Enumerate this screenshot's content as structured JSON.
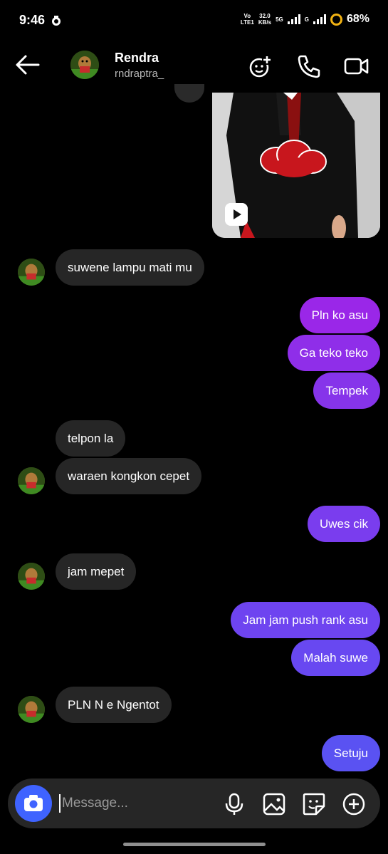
{
  "status_bar": {
    "time": "9:46",
    "volte_top": "Vo",
    "volte_bottom": "LTE1",
    "speed_top": "32.0",
    "speed_bottom": "KB/s",
    "net_5g": "5G",
    "net_g": "G",
    "battery": "68%"
  },
  "header": {
    "name": "Rendra",
    "username": "rndraptra_",
    "icons": [
      "back-arrow-icon",
      "add-effects-icon",
      "phone-icon",
      "video-icon"
    ]
  },
  "messages": [
    {
      "from": "them",
      "text": "suwene lampu mati mu"
    },
    {
      "from": "me",
      "text": "Pln ko asu"
    },
    {
      "from": "me",
      "text": "Ga teko teko"
    },
    {
      "from": "me",
      "text": "Tempek"
    },
    {
      "from": "them",
      "text": "telpon la"
    },
    {
      "from": "them",
      "text": "waraen kongkon cepet"
    },
    {
      "from": "me",
      "text": "Uwes cik"
    },
    {
      "from": "them",
      "text": "jam mepet"
    },
    {
      "from": "me",
      "text": "Jam jam push rank asu"
    },
    {
      "from": "me",
      "text": "Malah suwe"
    },
    {
      "from": "them",
      "text": "PLN N e Ngentot"
    },
    {
      "from": "me",
      "text": "Setuju"
    }
  ],
  "composer": {
    "placeholder": "Message...",
    "icons": [
      "camera-icon",
      "microphone-icon",
      "gallery-icon",
      "sticker-icon",
      "add-icon"
    ]
  },
  "colors": {
    "background": "#000000",
    "incoming_bubble": "#262626",
    "outgoing_top": "#9b25e8",
    "outgoing_bottom": "#5a52f2",
    "camera_button": "#3f63ff",
    "battery_ring": "#f2b313"
  }
}
